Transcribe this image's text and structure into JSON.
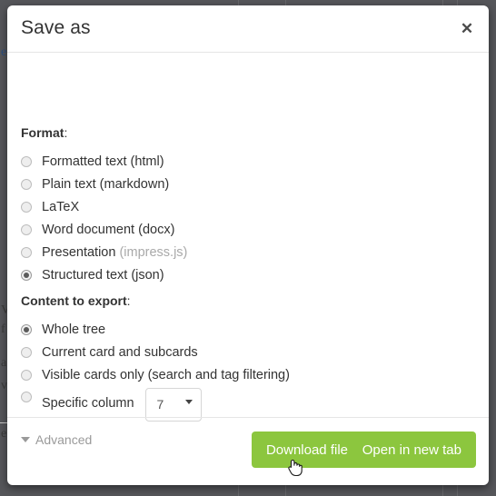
{
  "modal": {
    "title": "Save as",
    "close_icon": "close-icon",
    "format": {
      "label": "Format",
      "colon": ":",
      "options": [
        {
          "label": "Formatted text (html)",
          "muted": "",
          "selected": false
        },
        {
          "label": "Plain text (markdown)",
          "muted": "",
          "selected": false
        },
        {
          "label": "LaTeX",
          "muted": "",
          "selected": false
        },
        {
          "label": "Word document (docx)",
          "muted": "",
          "selected": false
        },
        {
          "label": "Presentation ",
          "muted": "(impress.js)",
          "selected": false
        },
        {
          "label": "Structured text (json)",
          "muted": "",
          "selected": true
        }
      ]
    },
    "content": {
      "label": "Content to export",
      "colon": ":",
      "options": [
        {
          "label": "Whole tree",
          "selected": true
        },
        {
          "label": "Current card and subcards",
          "selected": false
        },
        {
          "label": "Visible cards only (search and tag filtering)",
          "selected": false
        }
      ],
      "specific_column": {
        "label": "Specific column",
        "selected": false,
        "select_value": "7",
        "caret_icon": "chevron-down-icon"
      }
    },
    "advanced": {
      "caret_icon": "triangle-down-icon",
      "label": "Advanced"
    },
    "footer": {
      "download_label": "Download file",
      "open_tab_label": "Open in new tab"
    }
  },
  "background": {
    "fragments": [
      "e",
      "V",
      "f",
      "a",
      "v",
      "e"
    ],
    "overlay_color": "#55565a"
  },
  "colors": {
    "accent_green": "#8cc63e",
    "title_text": "#333333",
    "muted_text": "#a9a9a9"
  },
  "cursor": {
    "icon": "pointing-hand-cursor"
  }
}
